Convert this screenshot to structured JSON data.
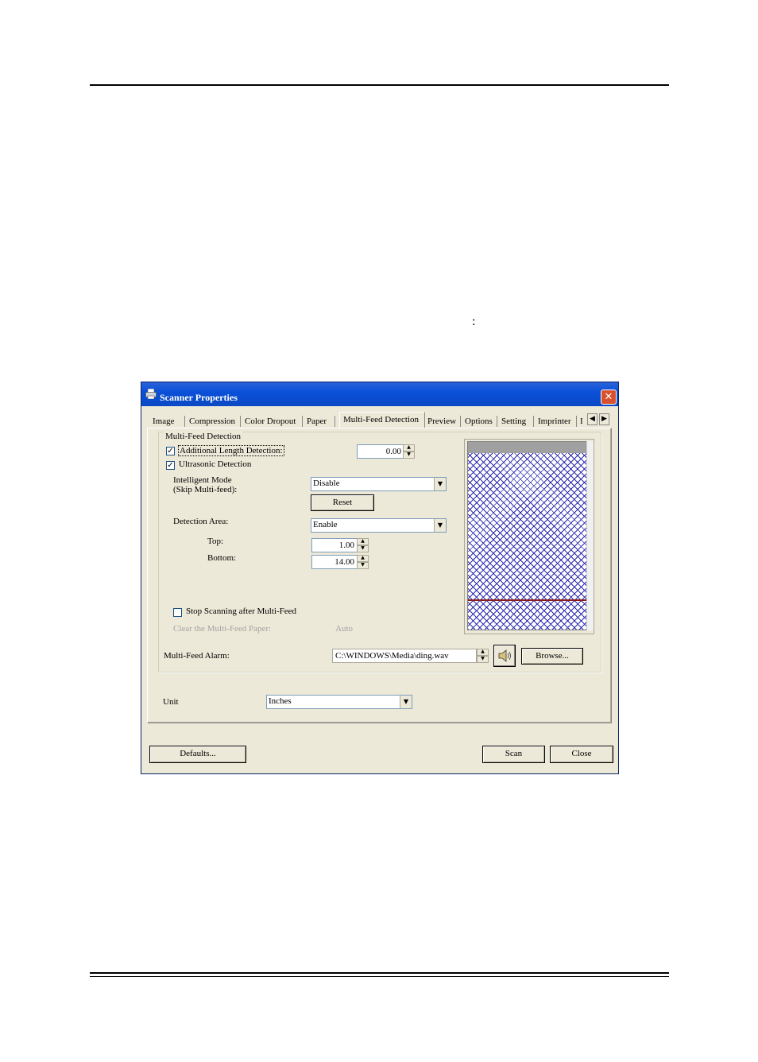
{
  "page": {
    "colon": ":"
  },
  "window": {
    "title": "Scanner Properties",
    "close_glyph": "✕",
    "tabs": [
      "Image",
      "Compression",
      "Color Dropout",
      "Paper",
      "Multi-Feed Detection",
      "Preview",
      "Options",
      "Setting",
      "Imprinter",
      "I"
    ],
    "active_tab": "Multi-Feed Detection",
    "tab_scroll_left": "◀",
    "tab_scroll_right": "▶"
  },
  "multifeed": {
    "group_title": "Multi-Feed Detection",
    "additional_length": {
      "label": "Additional Length Detection:",
      "checked": true,
      "value": "0.00"
    },
    "ultrasonic": {
      "label": "Ultrasonic Detection",
      "checked": true
    },
    "intelligent_mode": {
      "label_line1": "Intelligent Mode",
      "label_line2": "(Skip Multi-feed):",
      "value": "Disable"
    },
    "reset_label": "Reset",
    "detection_area": {
      "label": "Detection Area:",
      "value": "Enable"
    },
    "top": {
      "label": "Top:",
      "value": "1.00"
    },
    "bottom": {
      "label": "Bottom:",
      "value": "14.00"
    },
    "stop_scanning": {
      "label": "Stop Scanning after Multi-Feed",
      "checked": false
    },
    "clear_paper": {
      "label": "Clear the Multi-Feed Paper:",
      "value": "Auto"
    },
    "alarm": {
      "label": "Multi-Feed Alarm:",
      "value": "C:\\WINDOWS\\Media\\ding.wav",
      "browse_label": "Browse..."
    }
  },
  "unit": {
    "label": "Unit",
    "value": "Inches"
  },
  "footer": {
    "defaults_label": "Defaults...",
    "scan_label": "Scan",
    "close_label": "Close"
  },
  "icons": {
    "check": "✓",
    "dropdown": "▼",
    "spin_up": "▲",
    "spin_down": "▼",
    "speaker": "speaker-icon",
    "printer": "printer-icon"
  }
}
